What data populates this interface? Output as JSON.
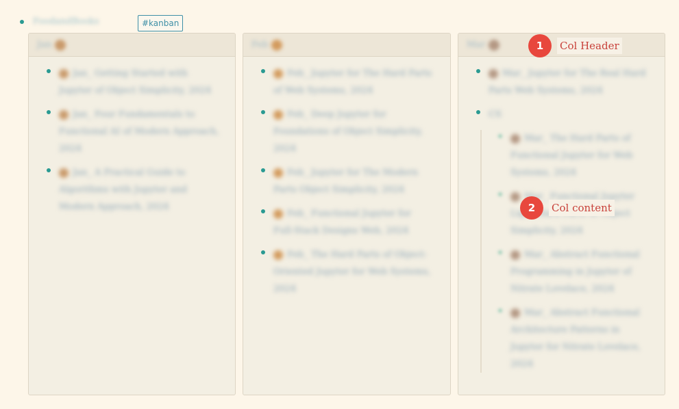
{
  "top": {
    "title": "FoodandBooks",
    "tag": "#kanban"
  },
  "columns": [
    {
      "title": "Jan",
      "avatar_color": "#c99a6b",
      "items": [
        "Jan_ Getting Started with Jupyter of Object Simplicity, 2024",
        "Jan_ Four Fundamentals to Functional AI of Modern Approach, 2024",
        "Jan_ A Practical Guide to Algorithms with Jupyter and Modern Approach, 2024"
      ]
    },
    {
      "title": "Feb",
      "avatar_color": "#d39b5e",
      "items": [
        "Feb_ Jupyter for The Hard Parts of Web Systems, 2024",
        "Feb_ Deep Jupyter for Foundations of Object Simplicity, 2024",
        "Feb_ Jupyter for The Modern Parts Object Simplicity, 2024",
        "Feb_ Functional Jupyter for Full-Stack Designs Web, 2024",
        "Feb_ The Hard Parts of Object-Oriented Jupyter for Web Systems, 2024"
      ]
    },
    {
      "title": "Mar",
      "avatar_color": "#b49884",
      "items": [
        "Mar_ Jupyter for The Real Hard Parts Web Systems, 2024"
      ],
      "group_label": "CS",
      "sub_items": [
        "Mar_ The Hard Parts of Functional Jupyter for Web Systems, 2024",
        "Mar_ Functional Jupyter Light Hard Parts of Object Simplicity, 2024",
        "Mar_ Abstract Functional Programming in Jupyter of Nitrate Lovelace, 2024",
        "Mar_ Abstract Functional Architecture Patterns in Jupyter for Nitrate Lovelace, 2024"
      ]
    }
  ],
  "annotations": [
    {
      "number": "1",
      "label": "Col Header"
    },
    {
      "number": "2",
      "label": "Col content"
    }
  ]
}
